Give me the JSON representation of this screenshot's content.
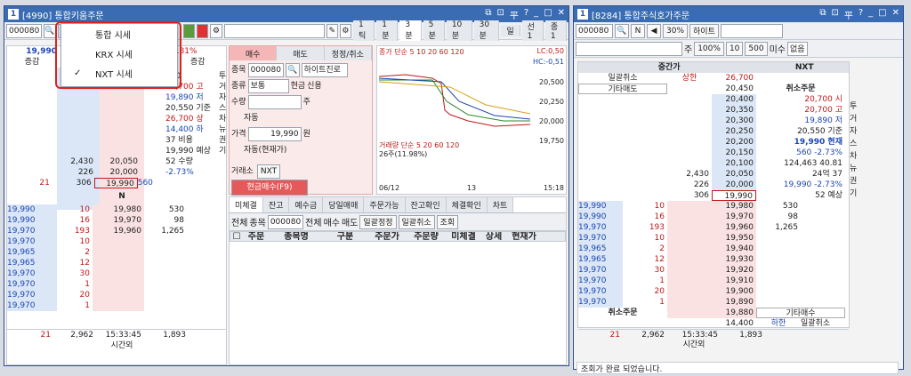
{
  "win1": {
    "num": "1",
    "title": "[4990] 통합키움주문",
    "code": "000080",
    "price": "19,990",
    "pct": "-40.81%",
    "menu": [
      "통합 시세",
      "KRX 시세",
      "NXT 시세"
    ],
    "checked_index": 2,
    "vols": [
      "200",
      "20,700 고",
      "19,890 저",
      "20,550 기준",
      "26,700 상",
      "14,400 하",
      "37 비용",
      "19,990 예상",
      "52 수량",
      "-2.73%"
    ],
    "labels": [
      "증감",
      "증감"
    ],
    "buy_tab": "매수",
    "sell_tab": "매도",
    "mod_tab": "정정/취소",
    "order": {
      "code_label": "종목",
      "code": "000080",
      "name": "하이트진로",
      "type_label": "종류",
      "type": "보통",
      "cash": "현금",
      "credit": "신용",
      "qty_label": "수량",
      "qty_unit": "주",
      "auto": "자동",
      "price_label": "가격",
      "price": "19,990",
      "price_unit": "원",
      "auto_cur": "자동(현재가)",
      "exch_label": "거래소",
      "exch": "NXT",
      "submit": "현금매수(F9)"
    },
    "chart_tabs": [
      "1틱",
      "1분",
      "3분",
      "5분",
      "10분",
      "30분",
      "일",
      "선1",
      "종1",
      "거"
    ],
    "chart_legend": "종가 단순 5 10 20 60 120",
    "lc": "LC:0,50",
    "hc": "HC:-0,51",
    "y_ticks": [
      "20,500",
      "20,250",
      "20,000",
      "19,750"
    ],
    "vol_legend": "거래량 단순 5 20 60 120",
    "vol_val": "26주(11.98%)",
    "x_labels": [
      "06/12",
      "13",
      "15:18"
    ],
    "bottom_tabs": [
      "미체결",
      "잔고",
      "예수금",
      "당일매매",
      "주문가능",
      "잔고확인",
      "체결확인",
      "차트"
    ],
    "filters": [
      "전체",
      "종목",
      "000080",
      "전체",
      "매수",
      "매도",
      "일괄정정",
      "일괄취소",
      "조회"
    ],
    "table_cols": [
      "주문",
      "종목명",
      "구분",
      "주문가",
      "주문량",
      "미체결",
      "상세",
      "현재가"
    ],
    "orderbook": {
      "sell_rows": [
        [
          "2,430",
          "20,050"
        ],
        [
          "226",
          "20,000"
        ],
        [
          "21",
          "306",
          "19,990"
        ]
      ],
      "n": "N",
      "buy_rows": [
        [
          "19,990",
          "10",
          "19,980",
          "530"
        ],
        [
          "19,990",
          "16",
          "19,970",
          "98"
        ],
        [
          "19,970",
          "193",
          "19,960",
          "1,265"
        ],
        [
          "19,970",
          "10",
          "",
          ""
        ],
        [
          "19,965",
          "2",
          "",
          ""
        ],
        [
          "19,965",
          "12",
          "",
          ""
        ],
        [
          "19,970",
          "30",
          "",
          ""
        ],
        [
          "19,970",
          "1",
          "",
          ""
        ],
        [
          "19,970",
          "20",
          "",
          ""
        ],
        [
          "19,970",
          "1",
          "",
          ""
        ]
      ],
      "totals": [
        "21",
        "2,962",
        "15:33:45",
        "1,893"
      ],
      "after": "시간외",
      "mid_buy": "560",
      "side_right": [
        "투",
        "거",
        "자",
        "스",
        "차",
        "뉴",
        "권",
        "기"
      ]
    }
  },
  "win2": {
    "num": "1",
    "title": "[8284] 통합주식호가주문",
    "code": "000080",
    "name": "하이트",
    "pct": "30%",
    "qty_label": "주",
    "qtys": [
      "100%",
      "10",
      "500"
    ],
    "misu": "미수",
    "none": "없음",
    "head": [
      "중간가",
      "NXT"
    ],
    "cancel_all": "일괄취소",
    "upper": "상한",
    "upper_val": "26,700",
    "misc_sell": "기타매도",
    "cancel_order": "취소주문",
    "misc_buy": "기타매수",
    "lower": "하한",
    "lower_val": "14,400",
    "asks": [
      "20,450",
      "20,400",
      "20,350",
      "20,300",
      "20,250",
      "20,200",
      "20,150",
      "20,100",
      "20,050",
      "20,000",
      "19,990"
    ],
    "ask_vols": [
      "",
      "",
      "",
      "",
      "",
      "",
      "",
      "",
      "2,430",
      "226",
      "306"
    ],
    "info": [
      "20,700 시",
      "20,700 고",
      "19,890 저",
      "20,550 기준",
      "19,990 현재",
      "560 -2.73%",
      "124,463 40.81",
      "24억 37",
      "19,990 -2.73%",
      "52 예상"
    ],
    "bids": [
      "19,980",
      "19,970",
      "19,960",
      "19,950",
      "19,940",
      "19,930",
      "19,920",
      "19,910",
      "19,900",
      "19,890",
      "19,880"
    ],
    "bid_vols": [
      "530",
      "98",
      "1,265",
      "",
      "",
      "",
      "",
      "",
      "",
      "",
      ""
    ],
    "left_prices": [
      "19,990",
      "19,990",
      "19,970",
      "19,970",
      "19,965",
      "19,965",
      "19,970",
      "19,970",
      "19,970",
      "19,970"
    ],
    "left_qty": [
      "10",
      "16",
      "193",
      "10",
      "2",
      "12",
      "30",
      "1",
      "20",
      "1"
    ],
    "totals": [
      "21",
      "2,962",
      "15:33:45",
      "1,893"
    ],
    "after": "시간외",
    "side": [
      "투",
      "거",
      "자",
      "스",
      "차",
      "뉴",
      "권",
      "기"
    ],
    "status": "조회가 완료 되었습니다."
  }
}
